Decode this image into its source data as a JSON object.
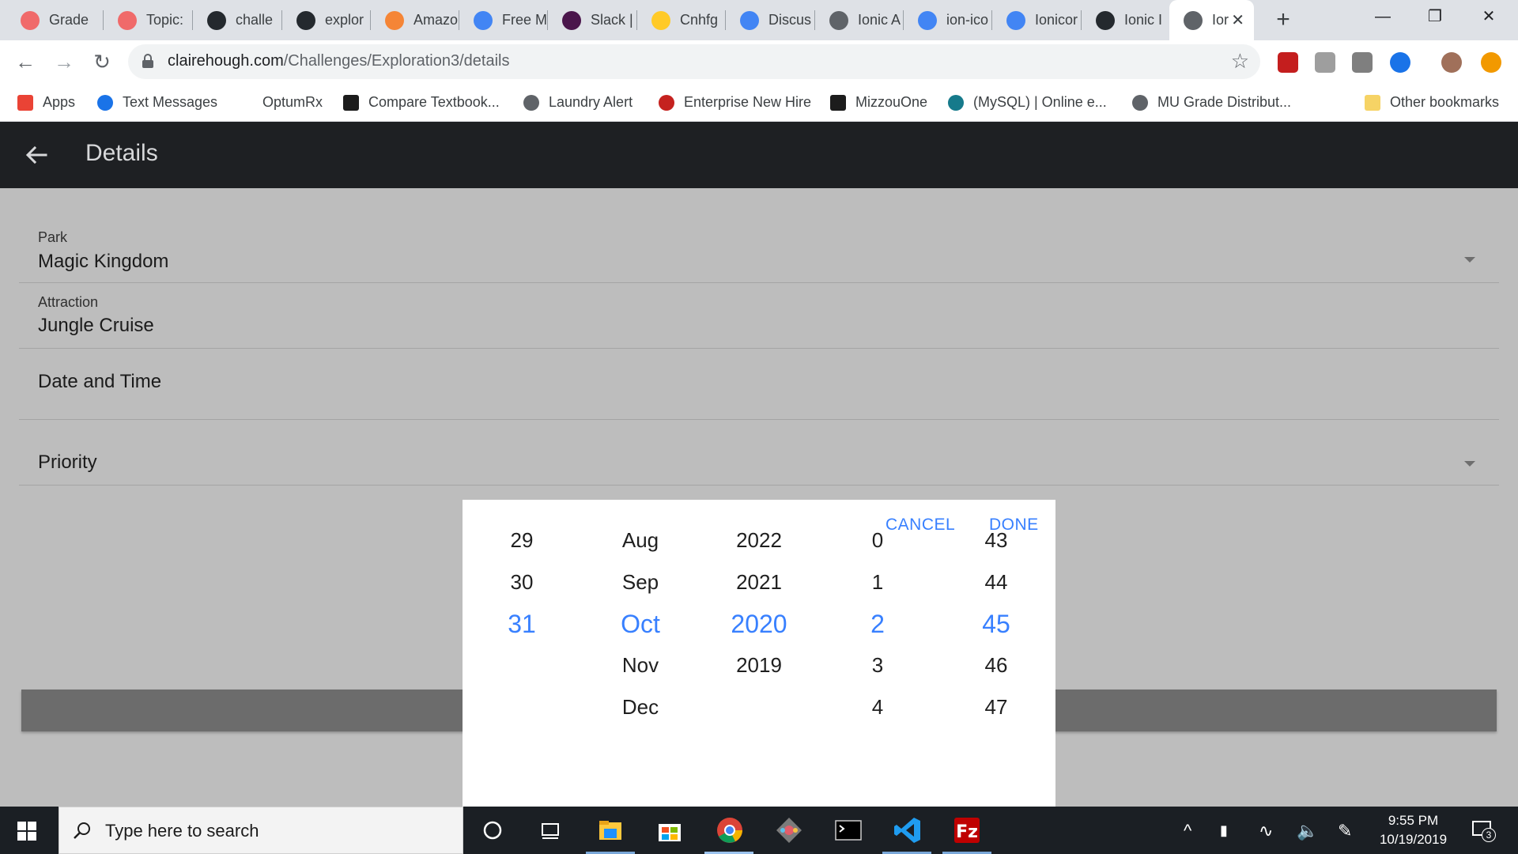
{
  "tabs": [
    {
      "label": "Grade",
      "icon": "asana-icon",
      "color": "#f06a6a"
    },
    {
      "label": "Topic:",
      "icon": "asana-icon",
      "color": "#f06a6a"
    },
    {
      "label": "challe",
      "icon": "github-icon",
      "color": "#24292e"
    },
    {
      "label": "explor",
      "icon": "github-icon",
      "color": "#24292e"
    },
    {
      "label": "Amazo",
      "icon": "aws-icon",
      "color": "#f58536"
    },
    {
      "label": "Free M",
      "icon": "radio-icon",
      "color": "#4285f4"
    },
    {
      "label": "Slack |",
      "icon": "slack-icon",
      "color": "#4a154b"
    },
    {
      "label": "Cnhfg",
      "icon": "firebase-icon",
      "color": "#ffca28"
    },
    {
      "label": "Discus",
      "icon": "docs-icon",
      "color": "#4285f4"
    },
    {
      "label": "Ionic A",
      "icon": "globe-icon",
      "color": "#5f6368"
    },
    {
      "label": "ion-ico",
      "icon": "google-icon",
      "color": "#4285f4"
    },
    {
      "label": "Ionicor",
      "icon": "radio-icon",
      "color": "#4285f4"
    },
    {
      "label": "Ionic I",
      "icon": "github-icon",
      "color": "#24292e"
    },
    {
      "label": "Ior",
      "icon": "globe-icon",
      "color": "#5f6368",
      "active": true
    }
  ],
  "address": {
    "host": "clairehough.com",
    "path": "/Challenges/Exploration3/details"
  },
  "bookmarks": [
    {
      "label": "Apps",
      "icon": "apps-grid-icon"
    },
    {
      "label": "Text Messages",
      "icon": "messages-icon"
    },
    {
      "label": "OptumRx",
      "icon": ""
    },
    {
      "label": "Compare Textbook...",
      "icon": "mizzou-icon"
    },
    {
      "label": "Laundry Alert",
      "icon": "globe-icon"
    },
    {
      "label": "Enterprise New Hire",
      "icon": "info-icon"
    },
    {
      "label": "MizzouOne",
      "icon": "mizzou-icon"
    },
    {
      "label": "(MySQL) | Online e...",
      "icon": "c-logo-icon"
    },
    {
      "label": "MU Grade Distribut...",
      "icon": "globe-icon"
    },
    {
      "label": "Other bookmarks",
      "icon": "folder-icon"
    }
  ],
  "app": {
    "title": "Details"
  },
  "form": {
    "park": {
      "label": "Park",
      "value": "Magic Kingdom"
    },
    "attraction": {
      "label": "Attraction",
      "value": "Jungle Cruise"
    },
    "datetime": {
      "label": "Date and Time"
    },
    "priority": {
      "label": "Priority"
    }
  },
  "picker": {
    "cancel": "CANCEL",
    "done": "DONE",
    "columns": {
      "day": [
        "29",
        "30",
        "31",
        ""
      ],
      "month": [
        "Aug",
        "Sep",
        "Oct",
        "Nov",
        "Dec"
      ],
      "year": [
        "2022",
        "2021",
        "2020",
        "2019"
      ],
      "hour": [
        "0",
        "1",
        "2",
        "3",
        "4"
      ],
      "minute": [
        "43",
        "44",
        "45",
        "46",
        "47"
      ]
    },
    "selected": {
      "day": "31",
      "month": "Oct",
      "year": "2020",
      "hour": "2",
      "minute": "45"
    }
  },
  "taskbar": {
    "search_placeholder": "Type here to search",
    "time": "9:55 PM",
    "date": "10/19/2019",
    "notifications": "3"
  },
  "colors": {
    "accent": "#3880ff",
    "header": "#1e2023",
    "backdrop": "#bdbdbd"
  }
}
